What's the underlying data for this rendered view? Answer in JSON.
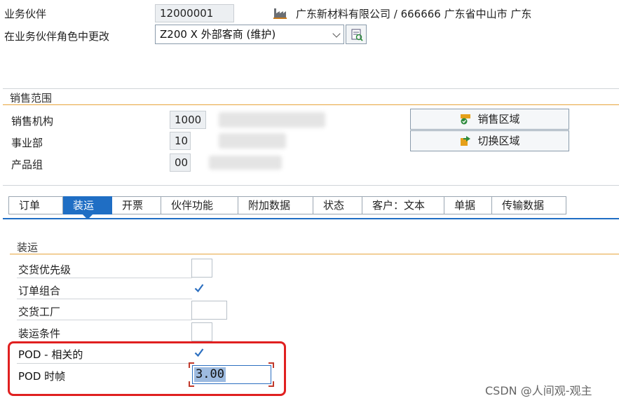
{
  "header": {
    "partner_label": "业务伙伴",
    "partner_value": "12000001",
    "partner_desc": "广东新材料有限公司 / 666666 广东省中山市 广东",
    "role_label": "在业务伙伴角色中更改",
    "role_value": "Z200  X 外部客商 (维护)"
  },
  "sales_area": {
    "title": "销售范围",
    "org_label": "销售机构",
    "org_value": "1000",
    "division_label": "事业部",
    "division_value": "10",
    "product_label": "产品组",
    "product_value": "00",
    "btn_sales_area": "销售区域",
    "btn_switch_area": "切换区域"
  },
  "tabs": [
    "订单",
    "装运",
    "开票",
    "伙伴功能",
    "附加数据",
    "状态",
    "客户：文本",
    "单据",
    "传输数据"
  ],
  "shipping": {
    "title": "装运",
    "delivery_priority_label": "交货优先级",
    "order_combination_label": "订单组合",
    "order_combination_checked": true,
    "delivery_plant_label": "交货工厂",
    "shipping_condition_label": "装运条件",
    "pod_relevant_label": "POD - 相关的",
    "pod_relevant_checked": true,
    "pod_timeframe_label": "POD 时帧",
    "pod_timeframe_value": "3.00"
  },
  "watermark": "CSDN @人间观-观主",
  "colors": {
    "accent": "#1f6ec4",
    "highlight_border": "#e02020",
    "section_line": "#e8a53c"
  }
}
